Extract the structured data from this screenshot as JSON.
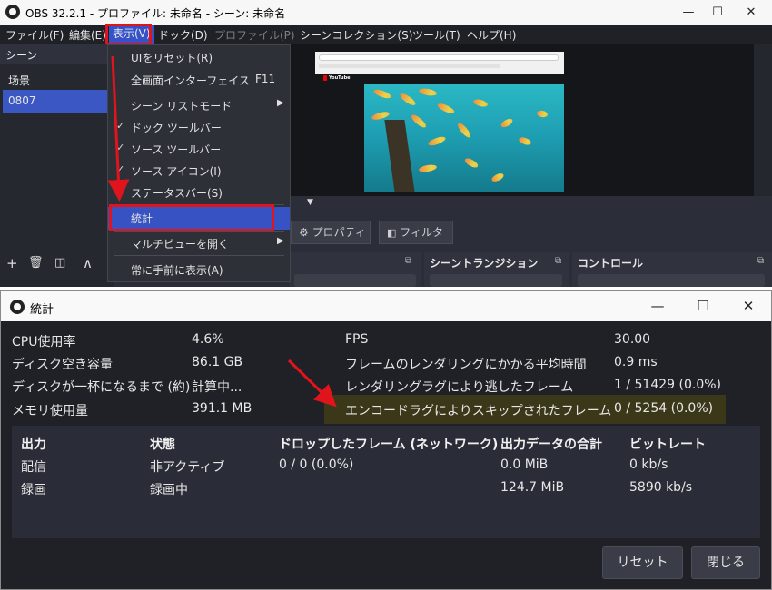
{
  "obs": {
    "title": "OBS 32.2.1 - プロファイル: 未命名 - シーン: 未命名",
    "window_controls": {
      "minimize": "—",
      "maximize": "☐",
      "close": "✕"
    },
    "menu": {
      "file": "ファイル(F)",
      "edit": "編集(E)",
      "view": "表示(V)",
      "dock": "ドック(D)",
      "profile": "プロファイル(P)",
      "scene_collection": "シーンコレクション(S)",
      "tools": "ツール(T)",
      "help": "ヘルプ(H)"
    },
    "scenes": {
      "header": "シーン",
      "items": [
        "场景",
        "0807"
      ]
    },
    "scene_toolbar": {
      "add": "+",
      "remove": "🗑",
      "filter": "◫",
      "up": "∧"
    },
    "preview": {
      "logo": "YouTube"
    },
    "buttons": {
      "properties": "プロパティ",
      "filters": "フィルタ"
    },
    "docks": {
      "transitions": "シーントランジション",
      "controls": "コントロール"
    },
    "view_menu": {
      "items": [
        {
          "label": "UIをリセット(R)",
          "check": "",
          "shortcut": "",
          "submenu": false
        },
        {
          "label": "全画面インターフェイス",
          "check": "",
          "shortcut": "F11",
          "submenu": false
        },
        {
          "label": "シーン リストモード",
          "check": "",
          "shortcut": "",
          "submenu": true
        },
        {
          "label": "ドック ツールバー",
          "check": "✓",
          "shortcut": "",
          "submenu": false
        },
        {
          "label": "ソース ツールバー",
          "check": "✓",
          "shortcut": "",
          "submenu": false
        },
        {
          "label": "ソース アイコン(I)",
          "check": "✓",
          "shortcut": "",
          "submenu": false
        },
        {
          "label": "ステータスバー(S)",
          "check": "✓",
          "shortcut": "",
          "submenu": false
        },
        {
          "label": "統計",
          "check": "",
          "shortcut": "",
          "submenu": false
        },
        {
          "label": "マルチビューを開く",
          "check": "",
          "shortcut": "",
          "submenu": true
        },
        {
          "label": "常に手前に表示(A)",
          "check": "",
          "shortcut": "",
          "submenu": false
        }
      ]
    }
  },
  "stats": {
    "title": "統計",
    "window_controls": {
      "minimize": "—",
      "maximize": "☐",
      "close": "✕"
    },
    "left": [
      {
        "label": "CPU使用率",
        "value": "4.6%"
      },
      {
        "label": "ディスク空き容量",
        "value": "86.1 GB"
      },
      {
        "label": "ディスクが一杯になるまで (約)",
        "value": "計算中..."
      },
      {
        "label": "メモリ使用量",
        "value": "391.1 MB"
      }
    ],
    "right": [
      {
        "label": "FPS",
        "value": "30.00"
      },
      {
        "label": "フレームのレンダリングにかかる平均時間",
        "value": "0.9 ms"
      },
      {
        "label": "レンダリングラグにより逃したフレーム",
        "value": "1 / 51429 (0.0%)"
      },
      {
        "label": "エンコードラグによりスキップされたフレーム",
        "value": "0 / 5254 (0.0%)"
      }
    ],
    "outputs": {
      "headers": [
        "出力",
        "状態",
        "ドロップしたフレーム (ネットワーク)",
        "出力データの合計",
        "ビットレート"
      ],
      "rows": [
        [
          "配信",
          "非アクティブ",
          "0 / 0 (0.0%)",
          "0.0 MiB",
          "0 kb/s"
        ],
        [
          "録画",
          "録画中",
          "",
          "124.7 MiB",
          "5890 kb/s"
        ]
      ]
    },
    "buttons": {
      "reset": "リセット",
      "close": "閉じる"
    }
  },
  "colors": {
    "highlight_red": "#e0141c",
    "selection_blue": "#3652c3",
    "highlight_row": "#3b3819"
  }
}
